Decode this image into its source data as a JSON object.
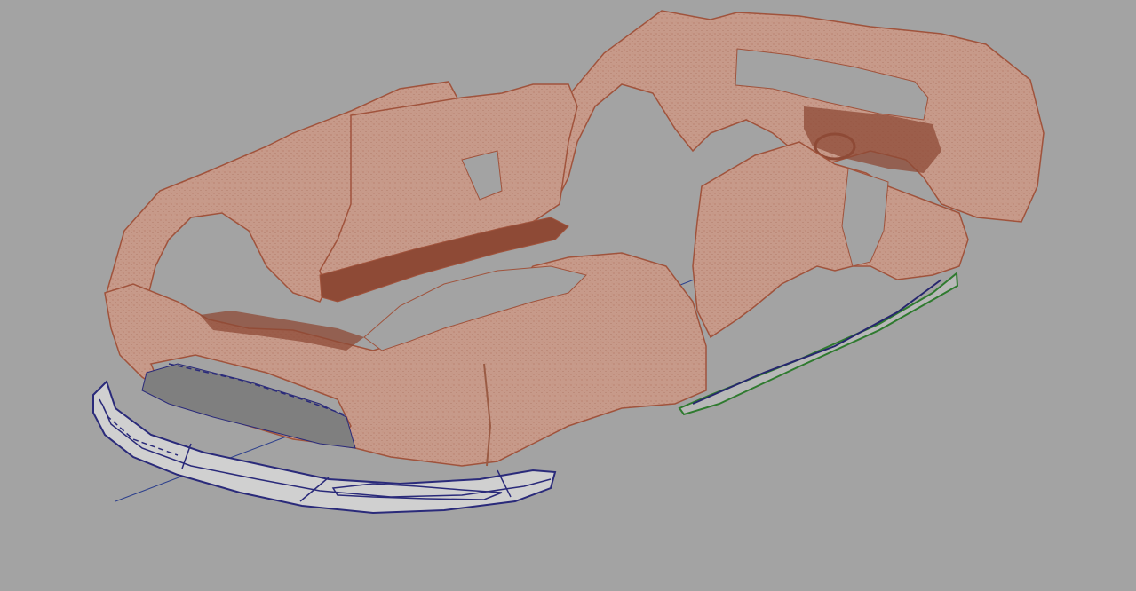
{
  "viewport": {
    "background_color": "#a3a3a3"
  },
  "scan": {
    "fill_color": "#c79a8a",
    "edge_color": "#a0533c",
    "noise_color": "#8e4a36"
  },
  "parts": {
    "front_splitter_color": "#2a2a7a",
    "splitter_fill_color": "#d0d0d0",
    "undertray_fill_color": "#7f7f7f",
    "side_skirt_color": "#2f7a2f",
    "side_skirt_outline_color": "#26266e",
    "axis_line_color": "#2c3f8c"
  }
}
